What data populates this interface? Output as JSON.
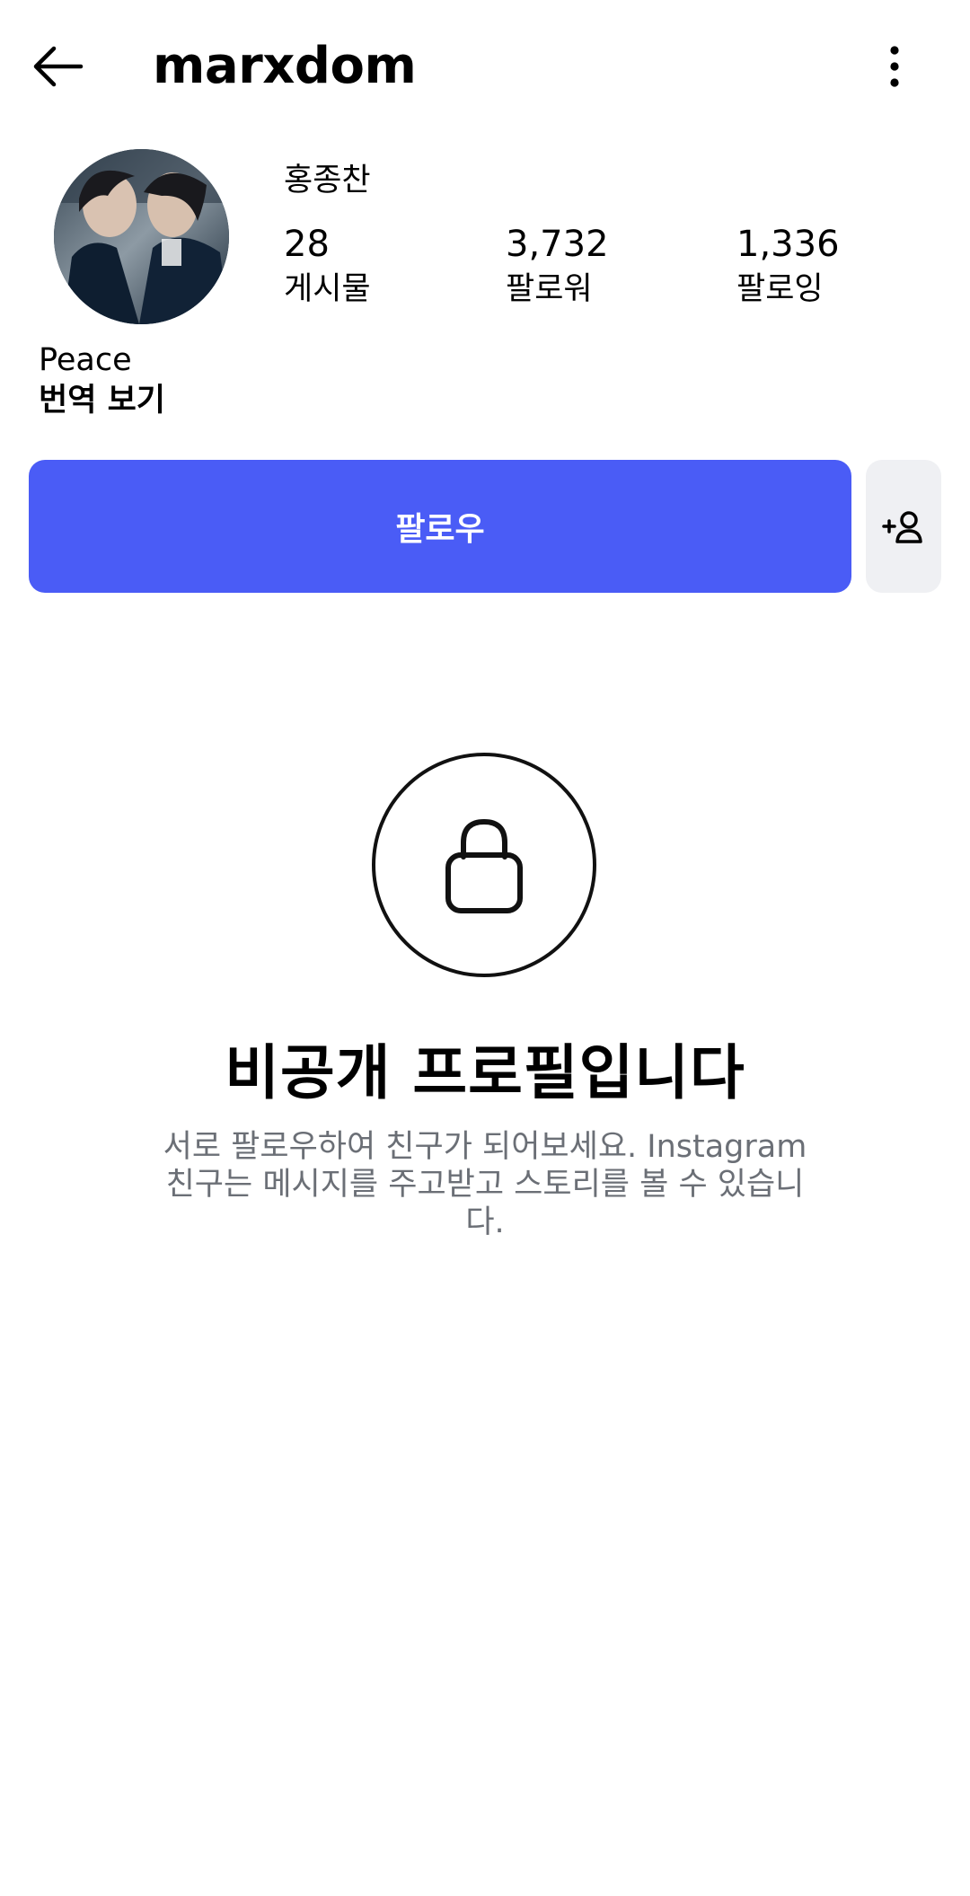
{
  "header": {
    "username": "marxdom",
    "back_icon": "arrow-left-icon",
    "more_icon": "more-vertical-icon"
  },
  "profile": {
    "full_name": "홍종찬",
    "avatar_icon": "profile-photo",
    "stats": [
      {
        "number": "28",
        "label": "게시물"
      },
      {
        "number": "3,732",
        "label": "팔로워"
      },
      {
        "number": "1,336",
        "label": "팔로잉"
      }
    ],
    "bio": "Peace",
    "translate_label": "번역 보기"
  },
  "actions": {
    "follow_label": "팔로우",
    "follow_color": "#4a5cf6",
    "suggest_icon": "add-person-icon"
  },
  "private_notice": {
    "icon": "lock-icon",
    "title": "비공개 프로필입니다",
    "description": "서로 팔로우하여 친구가 되어보세요. Instagram 친구는 메시지를 주고받고 스토리를 볼 수 있습니다."
  }
}
